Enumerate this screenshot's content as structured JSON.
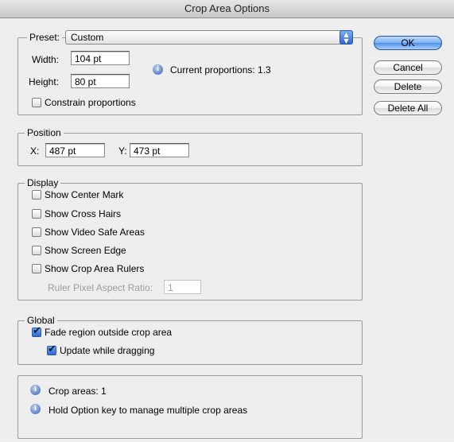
{
  "window": {
    "title": "Crop Area Options"
  },
  "preset": {
    "label": "Preset:",
    "value": "Custom"
  },
  "size": {
    "width_label": "Width:",
    "width_value": "104 pt",
    "height_label": "Height:",
    "height_value": "80 pt",
    "proportions_text": "Current proportions: 1.3",
    "constrain_label": "Constrain proportions",
    "constrain_checked": false
  },
  "position": {
    "legend": "Position",
    "x_label": "X:",
    "x_value": "487 pt",
    "y_label": "Y:",
    "y_value": "473 pt"
  },
  "display": {
    "legend": "Display",
    "show_center_mark": "Show Center Mark",
    "show_cross_hairs": "Show Cross Hairs",
    "show_video_safe_areas": "Show Video Safe Areas",
    "show_screen_edge": "Show Screen Edge",
    "show_crop_area_rulers": "Show Crop Area Rulers",
    "ruler_ratio_label": "Ruler Pixel Aspect Ratio:",
    "ruler_ratio_value": "1"
  },
  "global": {
    "legend": "Global",
    "fade_region": "Fade region outside crop area",
    "fade_region_checked": true,
    "update_dragging": "Update while dragging",
    "update_dragging_checked": true
  },
  "info": {
    "crop_areas": "Crop areas: 1",
    "hint": "Hold Option key to manage multiple crop areas"
  },
  "buttons": {
    "ok": "OK",
    "cancel": "Cancel",
    "delete": "Delete",
    "delete_all": "Delete All"
  },
  "icons": {
    "info": "info-icon",
    "select_arrows": "up-down-arrows-icon",
    "checkmark": "checkmark-icon"
  },
  "colors": {
    "accent": "#3a78de",
    "window_bg": "#ececec",
    "group_border": "#9b9b9b"
  }
}
